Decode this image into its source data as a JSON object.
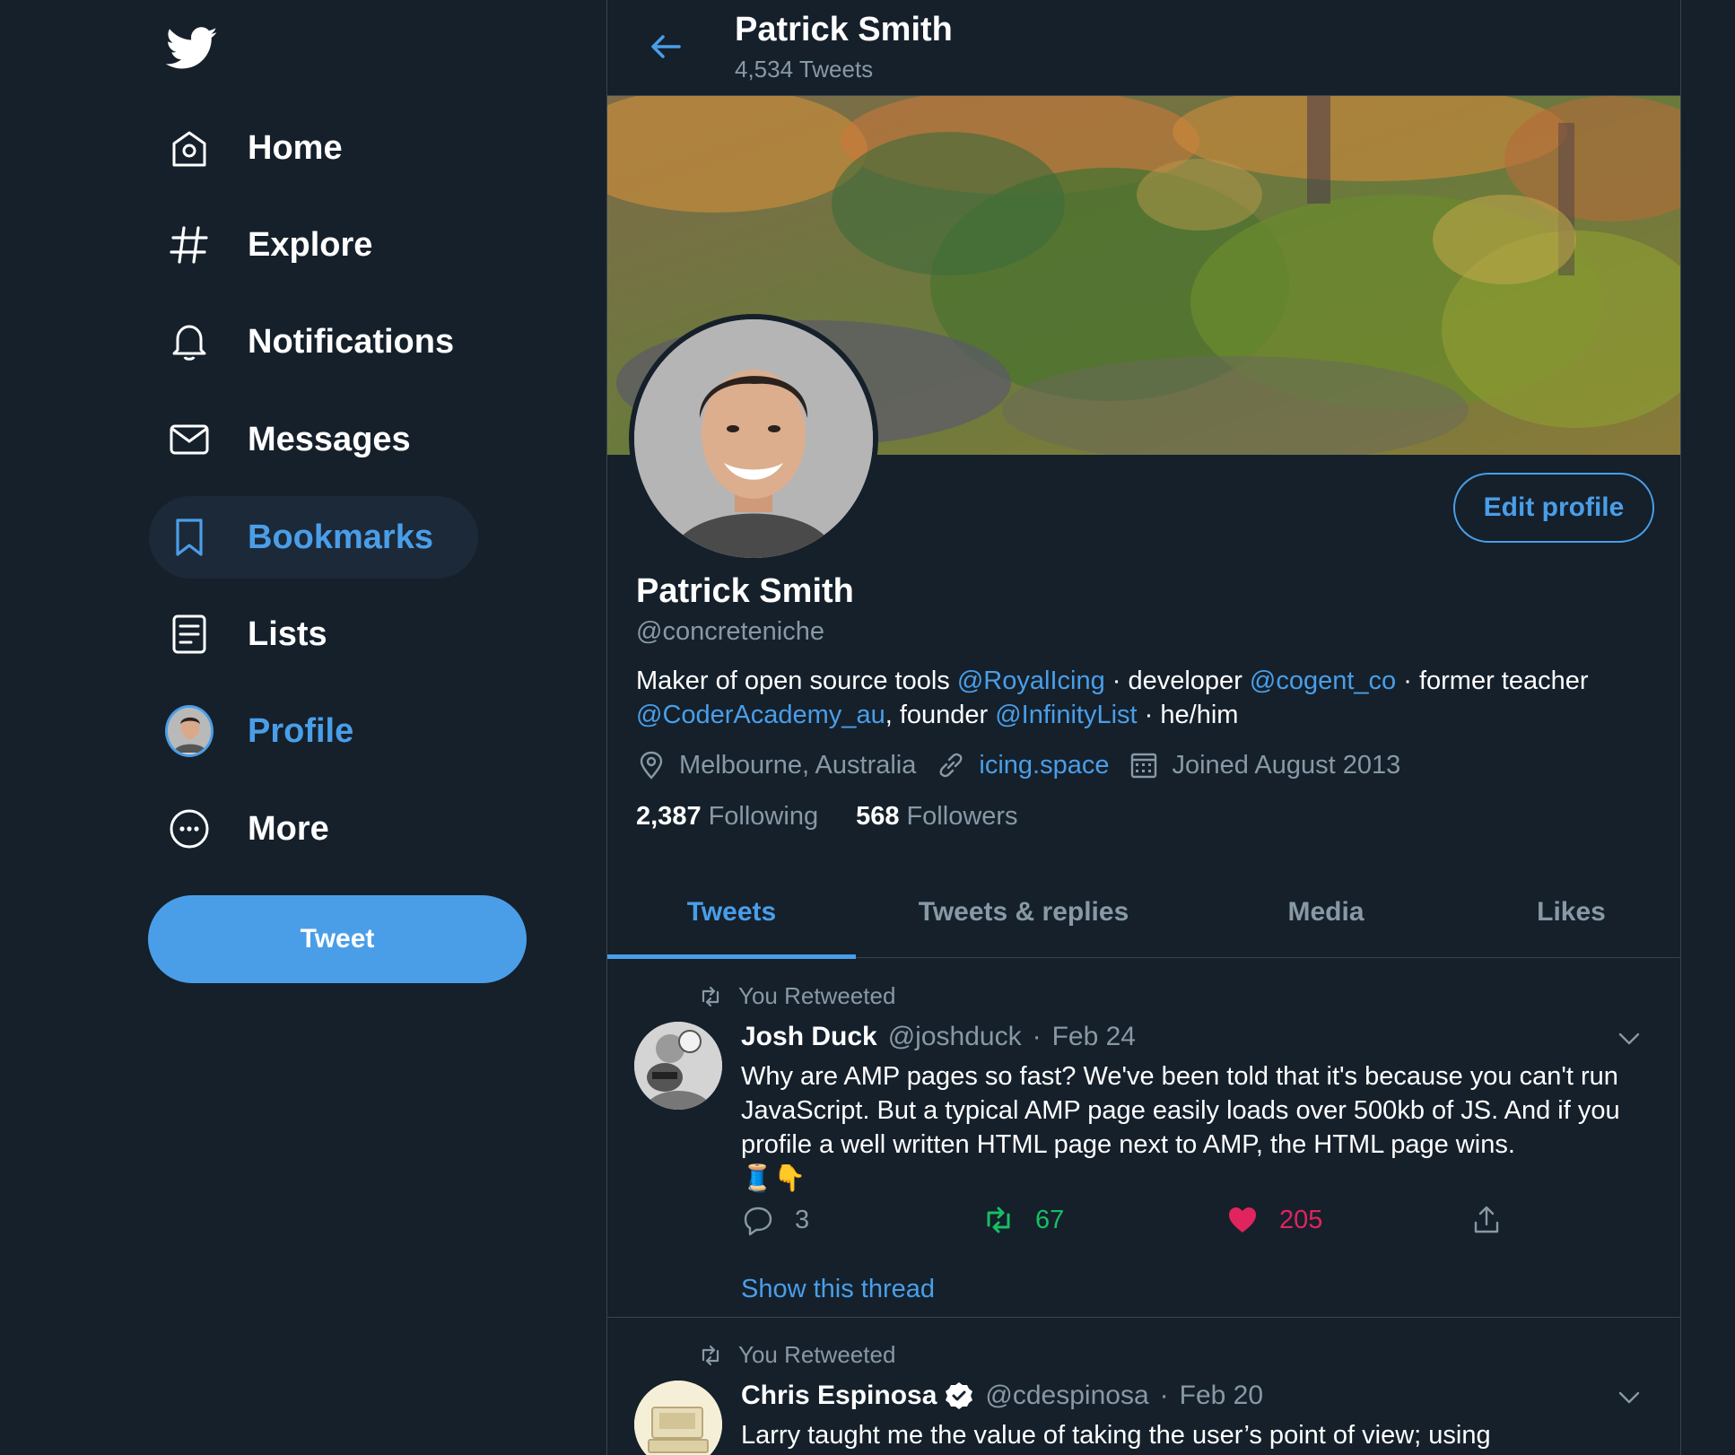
{
  "sidebar": {
    "items": [
      {
        "label": "Home",
        "icon": "home-icon"
      },
      {
        "label": "Explore",
        "icon": "hashtag-icon"
      },
      {
        "label": "Notifications",
        "icon": "bell-icon"
      },
      {
        "label": "Messages",
        "icon": "envelope-icon"
      },
      {
        "label": "Bookmarks",
        "icon": "bookmark-icon"
      },
      {
        "label": "Lists",
        "icon": "list-icon"
      },
      {
        "label": "Profile",
        "icon": "avatar"
      },
      {
        "label": "More",
        "icon": "more-circle-icon"
      }
    ],
    "tweet_button": "Tweet"
  },
  "header": {
    "title": "Patrick Smith",
    "subtitle": "4,534 Tweets"
  },
  "profile": {
    "name": "Patrick Smith",
    "handle": "@concreteniche",
    "edit_button": "Edit profile",
    "bio": {
      "t1": "Maker of open source tools ",
      "l1": "@RoyalIcing",
      "t2": " · developer ",
      "l2": "@cogent_co",
      "t3": " · former teacher ",
      "l3": "@CoderAcademy_au",
      "t4": ", founder ",
      "l4": "@InfinityList",
      "t5": " · he/him"
    },
    "location": "Melbourne, Australia",
    "website": "icing.space",
    "joined": "Joined August 2013",
    "following_count": "2,387",
    "following_label": "Following",
    "followers_count": "568",
    "followers_label": "Followers"
  },
  "tabs": [
    "Tweets",
    "Tweets & replies",
    "Media",
    "Likes"
  ],
  "tweets": [
    {
      "retweet_label": "You Retweeted",
      "name": "Josh Duck",
      "handle": "@joshduck",
      "sep": "·",
      "date": "Feb 24",
      "text": "Why are AMP pages so fast? We've been told that it's because you can't run JavaScript. But a typical AMP page easily loads over 500kb of JS. And if you profile a well written HTML page next to AMP, the HTML page wins.",
      "emoji": "🧵👇",
      "replies": "3",
      "retweets": "67",
      "likes": "205",
      "show_thread": "Show this thread"
    },
    {
      "retweet_label": "You Retweeted",
      "name": "Chris Espinosa",
      "handle": "@cdespinosa",
      "sep": "·",
      "date": "Feb 20",
      "text": "Larry taught me the value of taking the user’s point of view; using"
    }
  ],
  "colors": {
    "background": "#15202b",
    "accent": "#4a9ee8",
    "secondary_text": "#8899a6",
    "border": "#38444d",
    "retweet_green": "#17bf63",
    "like_pink": "#e0245e"
  }
}
